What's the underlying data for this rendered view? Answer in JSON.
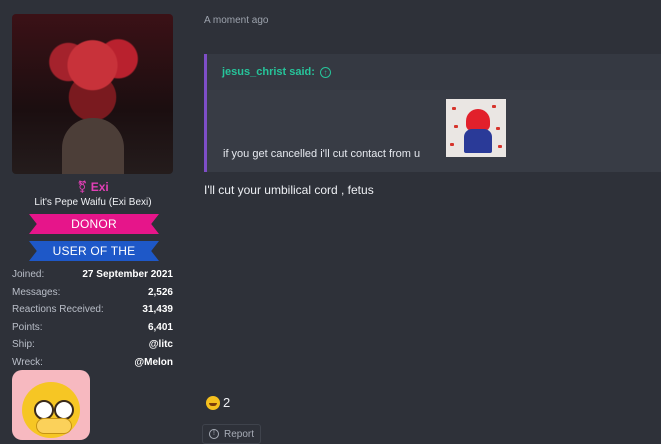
{
  "user": {
    "username": "Exi",
    "user_title": "Lit's Pepe Waifu (Exi Bexi)",
    "banners": [
      "DONOR",
      "USER OF THE MONTH"
    ],
    "stats": [
      {
        "label": "Joined:",
        "value": "27 September 2021"
      },
      {
        "label": "Messages:",
        "value": "2,526"
      },
      {
        "label": "Reactions Received:",
        "value": "31,439"
      },
      {
        "label": "Points:",
        "value": "6,401"
      },
      {
        "label": "Ship:",
        "value": "@litc"
      },
      {
        "label": "Wreck:",
        "value": "@Melon"
      }
    ]
  },
  "post": {
    "timestamp": "A moment ago",
    "quote": {
      "author_line": "jesus_christ said:",
      "text": "if you get cancelled i'll cut contact from u"
    },
    "reply_text": "I'll cut your umbilical cord , fetus",
    "reaction_count": "2",
    "report_label": "Report"
  }
}
